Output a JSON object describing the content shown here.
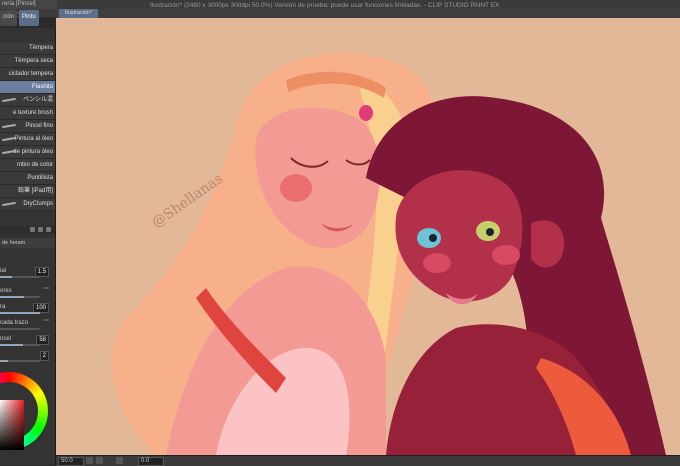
{
  "window": {
    "title": "Ilustración* (2480 x 3000px 300dpi 50.0%)  Versión de prueba: puede usar funciones limitadas. - CLIP STUDIO PAINT EX",
    "left_tab": "rería [Pincel]"
  },
  "panel_tabs": [
    {
      "label": "ción"
    },
    {
      "label": "Pintu"
    }
  ],
  "brushes": [
    {
      "label": "Témpera"
    },
    {
      "label": "Témpera seca"
    },
    {
      "label": "ciclador tempera"
    },
    {
      "label": "Flashito"
    },
    {
      "label": "ペンシル混"
    },
    {
      "label": "e texture brush"
    },
    {
      "label": "Pincel fino"
    },
    {
      "label": "Pintura al óleo"
    },
    {
      "label": "de pintura óleo"
    },
    {
      "label": "mbio de color"
    },
    {
      "label": "Puntillista"
    },
    {
      "label": "鉛筆 [iPad用]"
    },
    {
      "label": "DryClumps"
    }
  ],
  "tool_property": {
    "header": "de heram",
    "rows": [
      {
        "label": "ial",
        "value": "1.5",
        "level": 0.3
      },
      {
        "label": "ores",
        "value": "",
        "level": 0.6
      },
      {
        "label": "ra",
        "value": "100",
        "level": 1.0
      },
      {
        "label": "cada trazo",
        "value": "",
        "level": 0.0
      },
      {
        "label": "ncel",
        "value": "58",
        "level": 0.58
      },
      {
        "label": "",
        "value": "2",
        "level": 0.2
      }
    ]
  },
  "canvas": {
    "tab_label": "Ilustración*",
    "signature": "@Shellanas"
  },
  "statusbar": {
    "zoom": "50.0",
    "angle": "0.0"
  },
  "colors": {
    "canvas_bg": "#e2b898",
    "accent": "#5c6e87",
    "skin_left": "#f49a95",
    "hair_left": "#f7b08a",
    "skin_right": "#b2304a",
    "hair_right": "#7e1635"
  }
}
